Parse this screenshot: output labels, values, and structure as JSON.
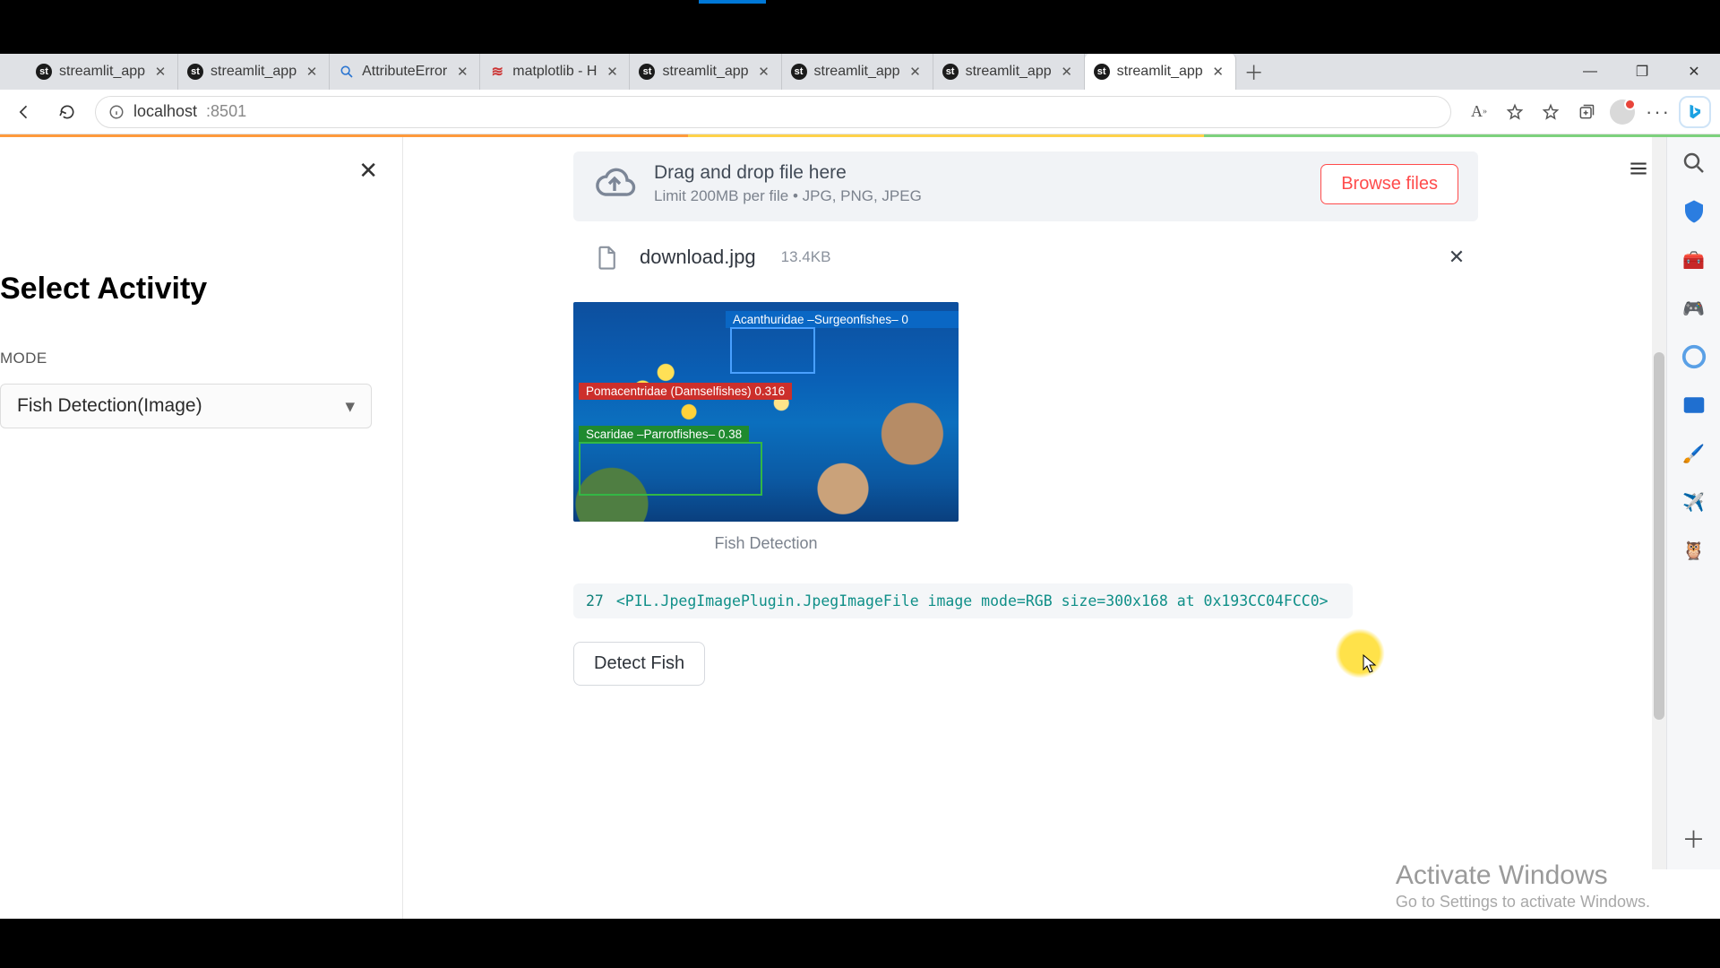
{
  "browser": {
    "tabs": [
      {
        "label": "streamlit_app",
        "icon": "dark"
      },
      {
        "label": "streamlit_app",
        "icon": "dark"
      },
      {
        "label": "AttributeError",
        "icon": "search"
      },
      {
        "label": "matplotlib - H",
        "icon": "java"
      },
      {
        "label": "streamlit_app",
        "icon": "dark"
      },
      {
        "label": "streamlit_app",
        "icon": "dark"
      },
      {
        "label": "streamlit_app",
        "icon": "dark"
      },
      {
        "label": "streamlit_app",
        "icon": "dark",
        "active": true
      }
    ],
    "url_host": "localhost",
    "url_path": ":8501"
  },
  "sidebar": {
    "title": "Select Activity",
    "mode_label": "MODE",
    "mode_value": "Fish Detection(Image)"
  },
  "uploader": {
    "line1": "Drag and drop file here",
    "line2": "Limit 200MB per file • JPG, PNG, JPEG",
    "browse": "Browse files"
  },
  "file": {
    "name": "download.jpg",
    "size": "13.4KB"
  },
  "detections": {
    "a": "Acanthuridae  –Surgeonfishes–  0",
    "b": "Pomacentridae (Damselfishes) 0.316",
    "c": "Scaridae  –Parrotfishes–  0.38"
  },
  "caption": "Fish Detection",
  "codeline": {
    "num": "27",
    "text": "<PIL.JpegImagePlugin.JpegImageFile image mode=RGB size=300x168 at 0x193CC04FCC0>"
  },
  "detect_button": "Detect Fish",
  "activate": {
    "l1": "Activate Windows",
    "l2": "Go to Settings to activate Windows."
  }
}
